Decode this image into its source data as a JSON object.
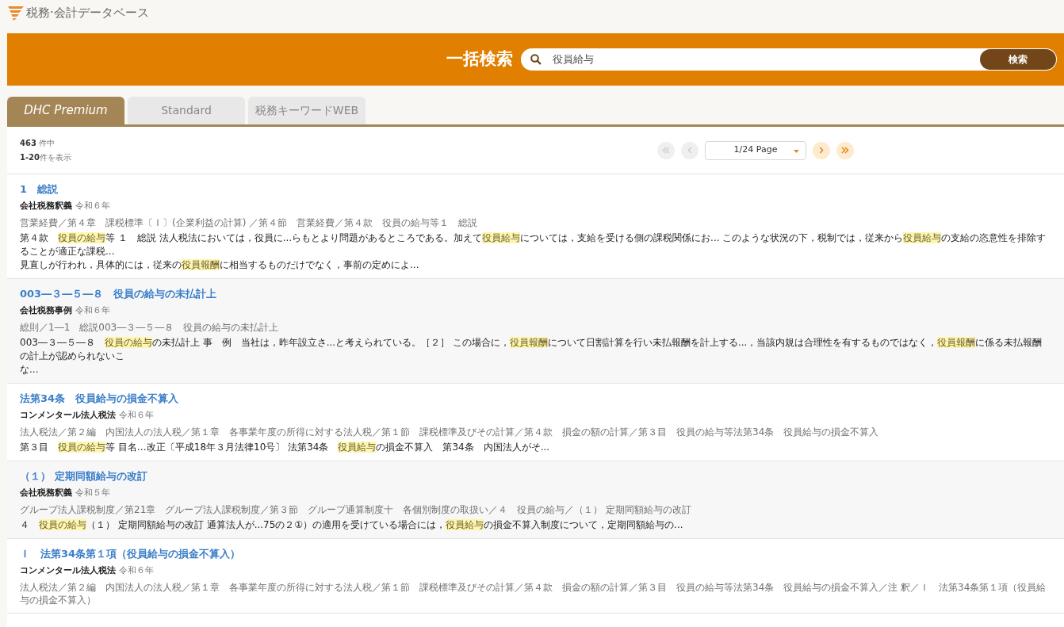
{
  "logo": {
    "text": "税務·会計データベース"
  },
  "search": {
    "title": "一括検索",
    "value": "役員給与",
    "button": "検索"
  },
  "tabs": [
    {
      "label": "DHC Premium",
      "selected": true,
      "italic": true
    },
    {
      "label": "Standard",
      "selected": false,
      "italic": false
    },
    {
      "label": "税務キーワードWEB",
      "selected": false,
      "italic": false
    }
  ],
  "summary": {
    "total": "463",
    "total_suffix": "件中",
    "range": "1-20",
    "range_suffix": "件を表示"
  },
  "pagination": {
    "buttons": [
      {
        "kind": "first",
        "disabled": true
      },
      {
        "kind": "prev",
        "disabled": true
      },
      {
        "kind": "select",
        "label": "1/24 Page"
      },
      {
        "kind": "next",
        "disabled": false
      },
      {
        "kind": "last",
        "disabled": false
      }
    ]
  },
  "results": [
    {
      "title": "1　総説",
      "source": "会社税務釈義",
      "year": "令和６年",
      "path": "営業経費／第４章　課税標準〔Ｉ〕(企業利益の計算) ／第４節　営業経費／第４款　役員の給与等１　総説",
      "snippet": [
        [
          {
            "text": "第４款　",
            "highlight": false
          },
          {
            "text": "役員の給与",
            "highlight": true
          },
          {
            "text": "等 １　総説 法人税法においては，役員に...らもとより問題があるところである。加えて",
            "highlight": false
          },
          {
            "text": "役員給与",
            "highlight": true
          },
          {
            "text": "については，支給を受ける側の課税関係にお... このような状況の下，税制では，従来から",
            "highlight": false
          },
          {
            "text": "役員給与",
            "highlight": true
          },
          {
            "text": "の支給の恣意性を排除することが適正な課税...",
            "highlight": false
          }
        ],
        [
          {
            "text": "見直しが行われ，具体的には，従来の",
            "highlight": false
          },
          {
            "text": "役員報酬",
            "highlight": true
          },
          {
            "text": "に相当するものだけでなく，事前の定めによ...",
            "highlight": false
          }
        ]
      ]
    },
    {
      "title": "003―３―５―８　役員の給与の未払計上",
      "source": "会社税務事例",
      "year": "令和６年",
      "path": "総則／1―1　総説003―３―５―８　役員の給与の未払計上",
      "snippet": [
        [
          {
            "text": "003―３―５―８　",
            "highlight": false
          },
          {
            "text": "役員の給与",
            "highlight": true
          },
          {
            "text": "の未払計上 事　例　当社は，昨年設立さ...と考えられている。［２］ この場合に，",
            "highlight": false
          },
          {
            "text": "役員報酬",
            "highlight": true
          },
          {
            "text": "について日割計算を行い未払報酬を計上する...，当該内規は合理性を有するものではなく，",
            "highlight": false
          },
          {
            "text": "役員報酬",
            "highlight": true
          },
          {
            "text": "に係る未払報酬の計上が認められないこ",
            "highlight": false
          }
        ],
        [
          {
            "text": "な...",
            "highlight": false
          }
        ]
      ]
    },
    {
      "title": "法第34条　役員給与の損金不算入",
      "source": "コンメンタール法人税法",
      "year": "令和６年",
      "path": "法人税法／第２編　内国法人の法人税／第１章　各事業年度の所得に対する法人税／第１節　課税標準及びその計算／第４款　損金の額の計算／第３目　役員の給与等法第34条　役員給与の損金不算入",
      "snippet": [
        [
          {
            "text": "第３目　",
            "highlight": false
          },
          {
            "text": "役員の給与",
            "highlight": true
          },
          {
            "text": "等 目名…改正〔平成18年３月法律10号〕 法第34条　",
            "highlight": false
          },
          {
            "text": "役員給与",
            "highlight": true
          },
          {
            "text": "の損金不算入　第34条　内国法人がそ...",
            "highlight": false
          }
        ]
      ]
    },
    {
      "title": "（１） 定期同額給与の改訂",
      "source": "会社税務釈義",
      "year": "令和５年",
      "path": "グループ法人課税制度／第21章　グループ法人課税制度／第３節　グループ通算制度十　各個別制度の取扱い／４　役員の給与／（１） 定期同額給与の改訂",
      "snippet": [
        [
          {
            "text": "４　",
            "highlight": false
          },
          {
            "text": "役員の給与",
            "highlight": true
          },
          {
            "text": "（１） 定期同額給与の改訂 通算法人が...75の２①）の適用を受けている場合には，",
            "highlight": false
          },
          {
            "text": "役員給与",
            "highlight": true
          },
          {
            "text": "の損金不算入制度について，定期同額給与の...",
            "highlight": false
          }
        ]
      ]
    },
    {
      "title": "Ｉ　法第34条第１項（役員給与の損金不算入）",
      "source": "コンメンタール法人税法",
      "year": "令和６年",
      "path": "法人税法／第２編　内国法人の法人税／第１章　各事業年度の所得に対する法人税／第１節　課税標準及びその計算／第４款　損金の額の計算／第３目　役員の給与等法第34条　役員給与の損金不算入／注 釈／Ｉ　法第34条第１項（役員給与の損金不算入）"
    }
  ]
}
